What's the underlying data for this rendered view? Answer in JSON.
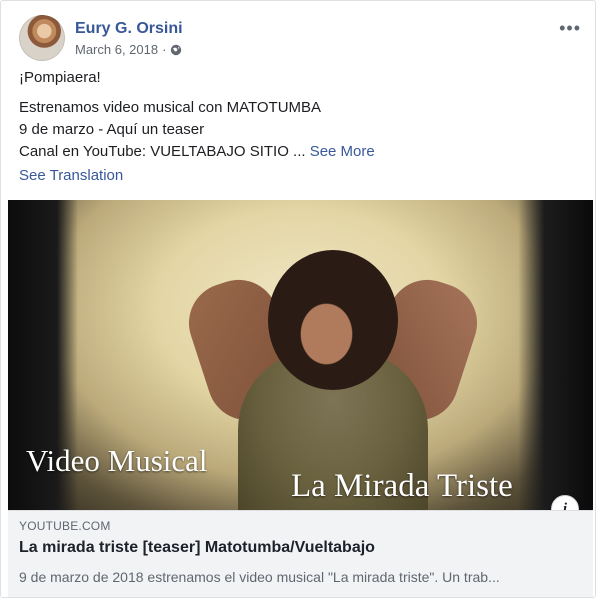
{
  "post": {
    "author": "Eury G. Orsini",
    "date": "March 6, 2018",
    "separator": "·",
    "privacy_icon": "globe-icon",
    "more_icon": "more-options-icon",
    "more_label": "•••",
    "text_lines": [
      "¡Pompiaera!",
      "Estrenamos video musical con MATOTUMBA",
      "9 de marzo - Aquí un teaser",
      "Canal en YouTube: VUELTABAJO SITIO ..."
    ],
    "see_more": "See More",
    "see_translation": "See Translation"
  },
  "video": {
    "caption_left": "Video Musical",
    "caption_right": "La Mirada Triste",
    "info_label": "i"
  },
  "link_preview": {
    "domain": "YOUTUBE.COM",
    "title": "La mirada triste [teaser] Matotumba/Vueltabajo",
    "description": "9 de marzo de 2018 estrenamos el video musical \"La mirada triste\". Un trab..."
  },
  "colors": {
    "link": "#385898",
    "meta": "#606770",
    "preview_bg": "#f2f3f5"
  }
}
